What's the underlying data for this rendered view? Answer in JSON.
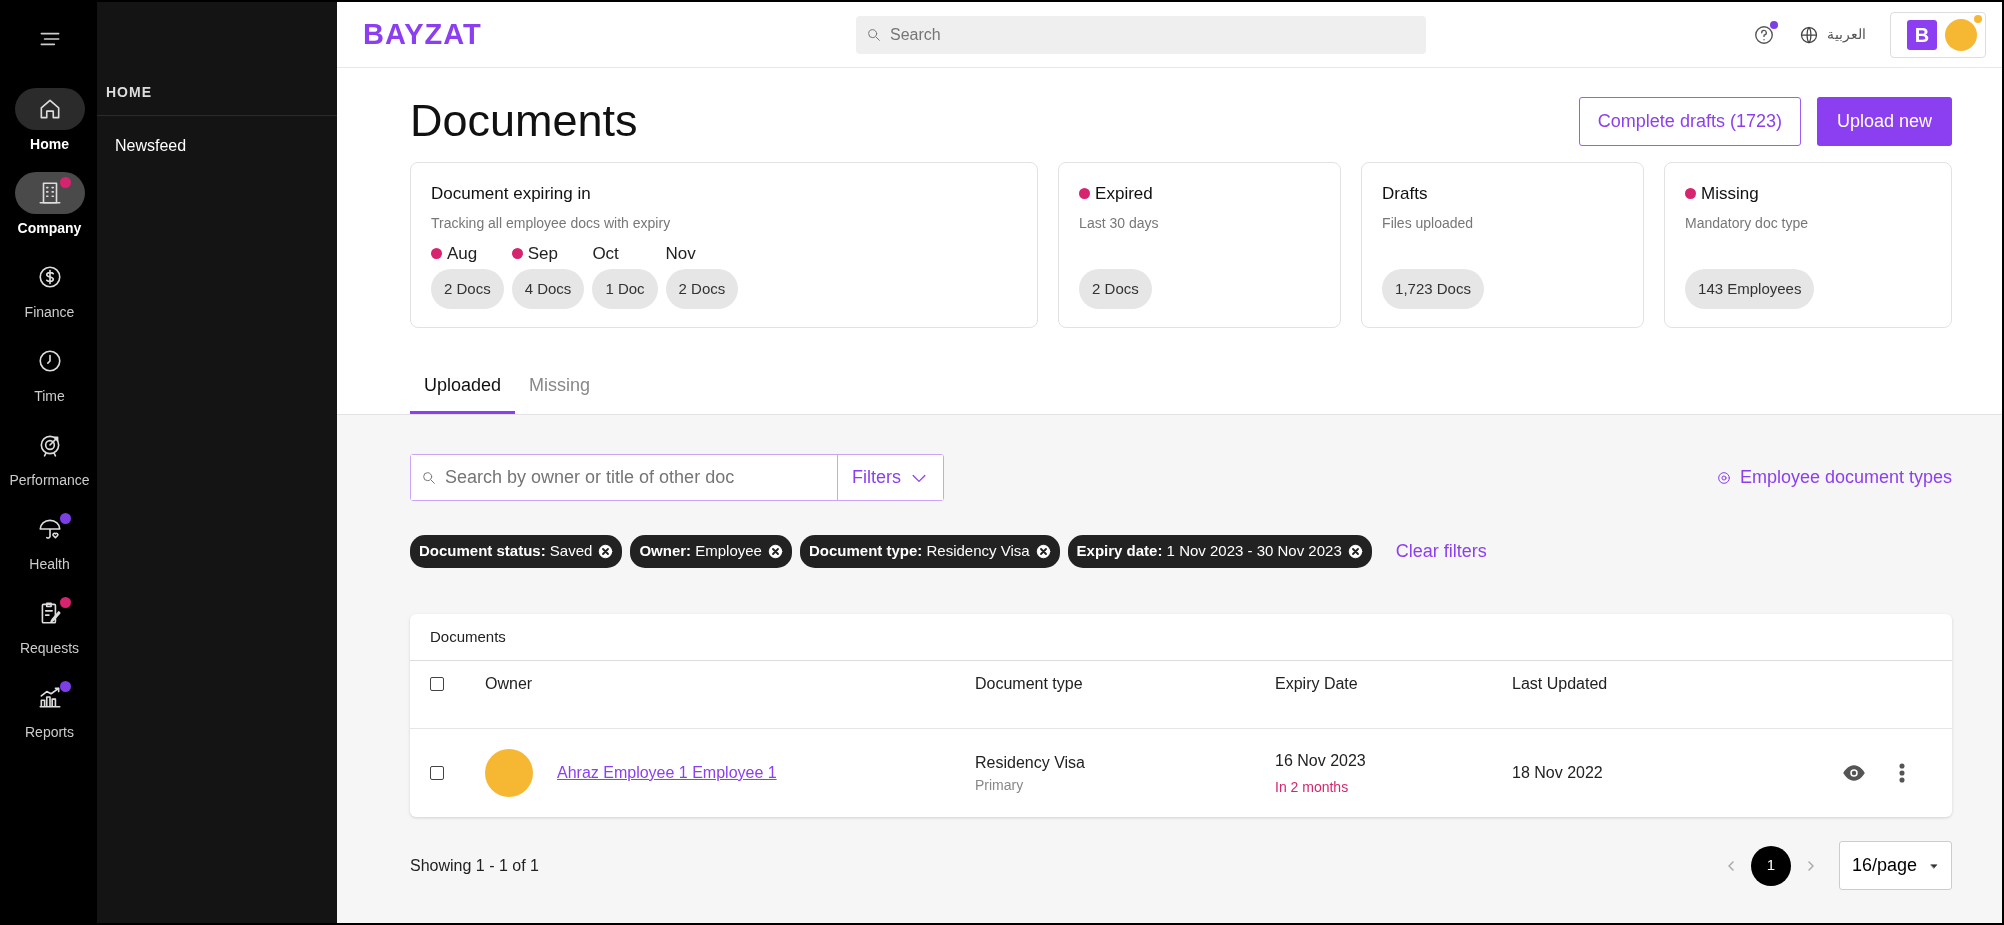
{
  "sidebar": {
    "items": [
      {
        "label": "Home",
        "hovered": true,
        "selected": false
      },
      {
        "label": "Company",
        "hovered": false,
        "selected": true,
        "color": "#d6246e"
      },
      {
        "label": "Finance",
        "hovered": false,
        "selected": false
      },
      {
        "label": "Time",
        "hovered": false,
        "selected": false
      },
      {
        "label": "Performance",
        "hovered": false,
        "selected": false
      },
      {
        "label": "Health",
        "hovered": false,
        "selected": false,
        "color": "#7b3fe4"
      },
      {
        "label": "Requests",
        "hovered": false,
        "selected": false,
        "color": "#d6246e"
      },
      {
        "label": "Reports",
        "hovered": false,
        "selected": false,
        "color": "#7b3fe4"
      }
    ]
  },
  "subpanel": {
    "heading": "HOME",
    "items": [
      "Newsfeed"
    ]
  },
  "header": {
    "logo": "BAYZAT",
    "search": {
      "placeholder": "Search"
    },
    "help_notification": true,
    "language": "العربية",
    "company_initial": "B",
    "avatar_notification": true
  },
  "page": {
    "title": "Documents",
    "buttons": [
      {
        "label": "Complete drafts (1723)",
        "kind": "outline"
      },
      {
        "label": "Upload new",
        "kind": "primary"
      }
    ]
  },
  "expiring_card": {
    "title": "Document expiring in",
    "subtitle": "Tracking all employee docs with expiry",
    "months": [
      {
        "label": "Aug",
        "alert": true,
        "count": "2 Docs"
      },
      {
        "label": "Sep",
        "alert": true,
        "count": "4 Docs"
      },
      {
        "label": "Oct",
        "alert": false,
        "count": "1 Doc"
      },
      {
        "label": "Nov",
        "alert": false,
        "count": "2 Docs"
      }
    ]
  },
  "summary_cards": [
    {
      "title": "Expired",
      "alert": true,
      "subtitle": "Last 30 days",
      "count": "2 Docs"
    },
    {
      "title": "Drafts",
      "alert": false,
      "subtitle": "Files uploaded",
      "count": "1,723 Docs"
    },
    {
      "title": "Missing",
      "alert": true,
      "subtitle": "Mandatory doc type",
      "count": "143 Employees"
    }
  ],
  "tabs": [
    {
      "label": "Uploaded",
      "selected": true
    },
    {
      "label": "Missing",
      "selected": false
    }
  ],
  "filter_bar": {
    "search": {
      "placeholder": "Search by owner or title of other doc"
    },
    "filters_button": "Filters",
    "types_link": "Employee document types"
  },
  "chips": [
    "**Document status:** Saved",
    "**Owner:** Employee",
    "**Document type:** Residency Visa",
    "**Expiry date:** 1 Nov 2023 - 30 Nov 2023"
  ],
  "clear_filters": "Clear filters",
  "table": {
    "title": "Documents",
    "select_all_checked": false,
    "columns": [
      "Owner",
      "Document type",
      "Expiry Date",
      "Last Updated"
    ],
    "rows": [
      {
        "checked": false,
        "owner": "Ahraz Employee 1 Employee 1",
        "document_type": "Residency Visa",
        "document_subtype": "Primary",
        "expiry_date": "16 Nov 2023",
        "expiry_note": "In 2 months",
        "last_updated": "18 Nov 2022"
      }
    ]
  },
  "footer": {
    "showing": "Showing 1 - 1 of 1",
    "pages": [
      {
        "label": "1",
        "selected": true
      }
    ],
    "per_page": "16/page"
  }
}
